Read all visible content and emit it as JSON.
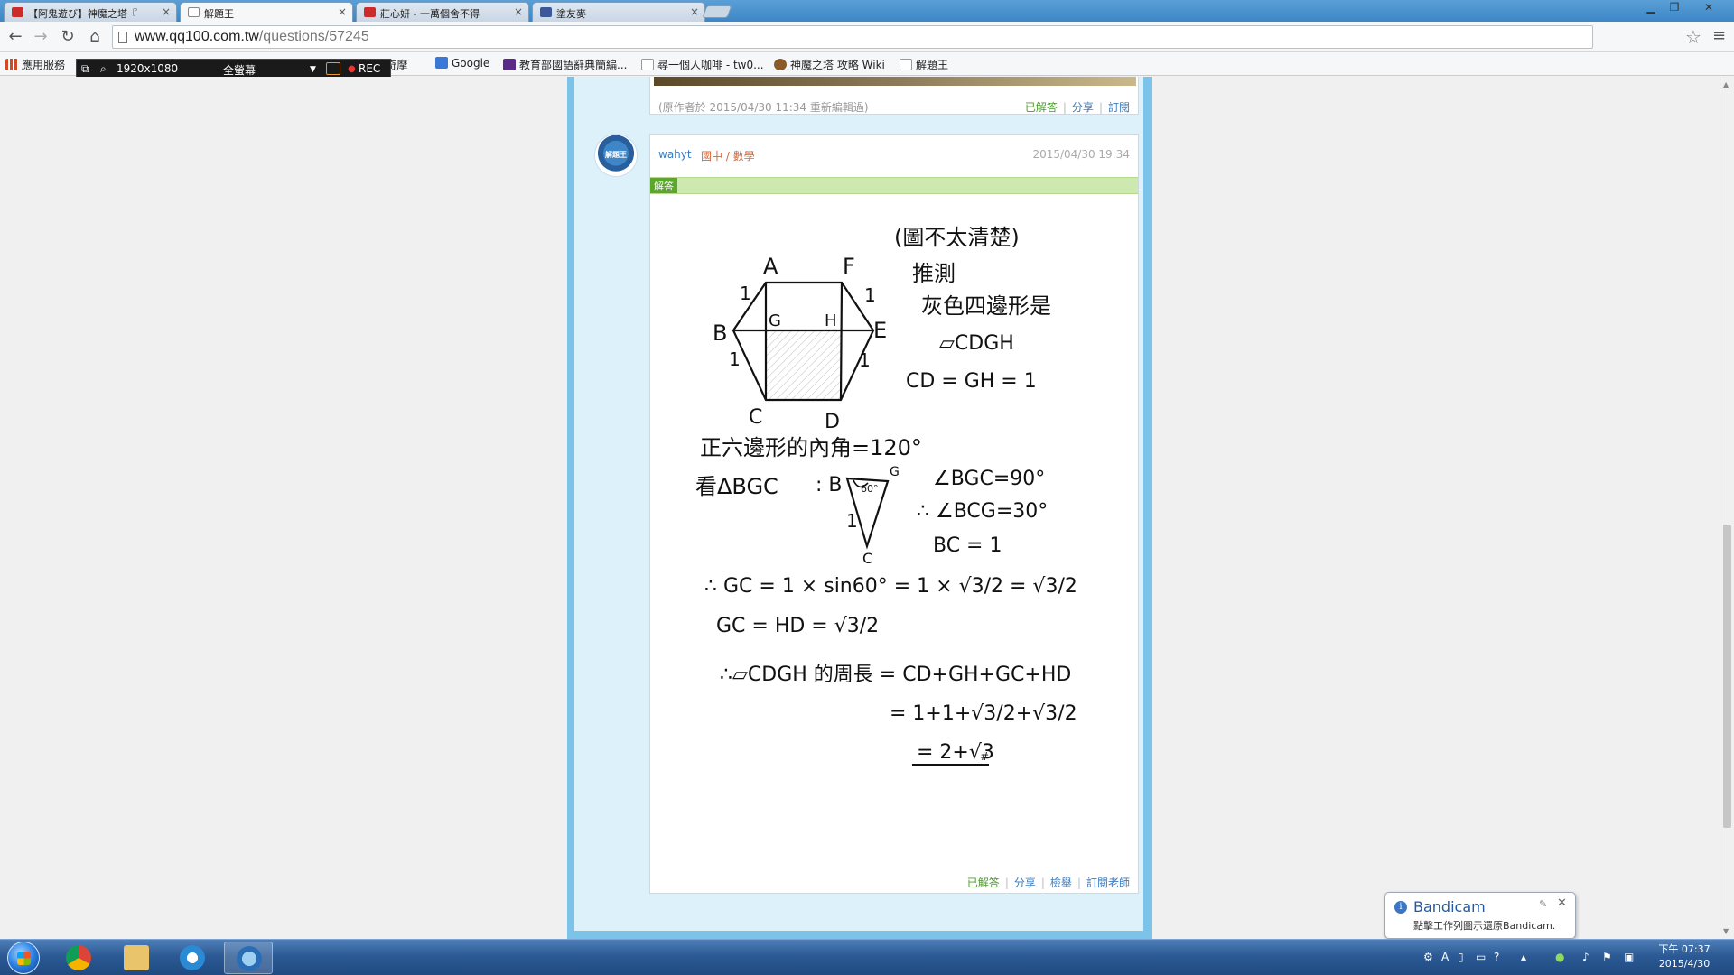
{
  "browser": {
    "tabs": [
      {
        "label": "【阿鬼遊び】神魔之塔『",
        "icon_color": "#cc2b2b",
        "active": false
      },
      {
        "label": "解題王",
        "icon_color": "#888888",
        "active": true
      },
      {
        "label": "莊心妍 - 一萬個舍不得",
        "icon_color": "#cc2b2b",
        "active": false
      },
      {
        "label": "塗友麥",
        "icon_color": "#3b5998",
        "active": false
      }
    ],
    "url_host": "www.qq100.com.tw",
    "url_path": "/questions/57245",
    "bookmarks": [
      {
        "label": "應用服務",
        "icon_color": "#d04a2a"
      },
      {
        "label": "Yahoo奇摩",
        "icon_color": "#5b2a86"
      },
      {
        "label": "Google",
        "icon_color": "#3a78d8"
      },
      {
        "label": "教育部國語辭典簡編...",
        "icon_color": "#5b2a86"
      },
      {
        "label": "尋一個人咖啡 - tw0...",
        "icon_color": "#cccccc"
      },
      {
        "label": "神魔之塔 攻略 Wiki",
        "icon_color": "#8a5a2a"
      },
      {
        "label": "解題王",
        "icon_color": "#cccccc"
      }
    ]
  },
  "bandicam_bar": {
    "resolution": "1920x1080",
    "mode": "全螢幕",
    "rec": "REC"
  },
  "prev_post": {
    "edited_note": "(原作者於 2015/04/30 11:34 重新編輯過)",
    "actions": [
      "已解答",
      "分享",
      "訂閱"
    ]
  },
  "answer_post": {
    "username": "wahyt",
    "category": "國中 / 數學",
    "timestamp": "2015/04/30 19:34",
    "badge": "解答",
    "actions": [
      "已解答",
      "分享",
      "檢舉",
      "訂閱老師"
    ],
    "avatar_text": "解題王"
  },
  "handwriting": {
    "note_title": "(圖不太清楚)",
    "note_1": "推測",
    "note_2": "灰色四邊形是",
    "note_3": "▱CDGH",
    "note_4": "CD = GH = 1",
    "labels": {
      "A": "A",
      "F": "F",
      "B": "B",
      "E": "E",
      "C": "C",
      "D": "D",
      "G": "G",
      "H": "H",
      "one": "1"
    },
    "line_1": "正六邊形的內角=120°",
    "line_2a": "看ΔBGC",
    "line_2b": ": B",
    "tri_angle": "60°",
    "tri_side": "1",
    "tri_G": "G",
    "tri_C": "C",
    "line_2c": "∠BGC=90°",
    "line_2d": "∴ ∠BCG=30°",
    "line_2e": "BC = 1",
    "line_3": "∴ GC = 1 × sin60° = 1 × √3/2 = √3/2",
    "line_4": "GC = HD = √3/2",
    "line_5": "∴▱CDGH 的周長 = CD+GH+GC+HD",
    "line_6": "= 1+1+√3/2+√3/2",
    "line_7": "= 2+√3",
    "line_7_mark": "#"
  },
  "notification": {
    "title": "Bandicam",
    "message": "點擊工作列圖示還原Bandicam."
  },
  "taskbar": {
    "clock_time": "下午 07:37",
    "clock_date": "2015/4/30"
  }
}
